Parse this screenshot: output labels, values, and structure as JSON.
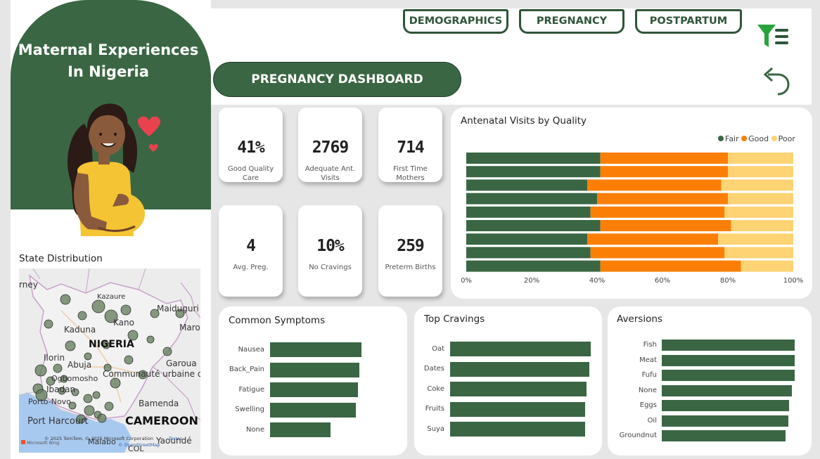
{
  "app": {
    "title_line1": "Maternal Experiences",
    "title_line2": "In Nigeria"
  },
  "nav": {
    "demographics": "DEMOGRAPHICS",
    "pregnancy": "PREGNANCY",
    "postpartum": "POSTPARTUM",
    "filter_icon": "filter-list-icon",
    "back_icon": "undo-arrow-icon"
  },
  "dashboard_title": "PREGNANCY DASHBOARD",
  "colors": {
    "green": "#3a6644",
    "orange": "#fb7f07",
    "yellow": "#fdd374"
  },
  "kpis": [
    {
      "value": "41%",
      "label1": "Good Quality",
      "label2": "Care"
    },
    {
      "value": "2769",
      "label1": "Adequate Ant.",
      "label2": "Visits"
    },
    {
      "value": "714",
      "label1": "First Time",
      "label2": "Mothers"
    },
    {
      "value": "4",
      "label1": "Avg. Preg.",
      "label2": ""
    },
    {
      "value": "10%",
      "label1": "No Cravings",
      "label2": ""
    },
    {
      "value": "259",
      "label1": "Preterm Births",
      "label2": ""
    }
  ],
  "state_distribution": {
    "title": "State Distribution",
    "map_labels": [
      "rney",
      "Kazaure",
      "Maiduguri",
      "Kano",
      "Kaduna",
      "Maro",
      "NIGERIA",
      "Ilorin",
      "Abuja",
      "Garoua",
      "Communauté urbaine d",
      "Ibadan",
      "Ogbomosho",
      "Porto-Novo",
      "Bamenda",
      "Port Harcourt",
      "CAMEROON",
      "Malabo",
      "Yaoundé",
      "COL"
    ],
    "attribution": "© 2025 TomTom, © 2025 Microsoft Corporation",
    "attribution2": "© OpenStreetMap",
    "terms": "Terms",
    "bing": "Microsoft Bing"
  },
  "chart_data": [
    {
      "type": "bar",
      "title": "Antenatal Visits by Quality",
      "orientation": "horizontal-stacked-100",
      "legend": [
        "Fair",
        "Good",
        "Poor"
      ],
      "legend_position": "top-right",
      "xticks": [
        "0%",
        "20%",
        "40%",
        "60%",
        "80%",
        "100%"
      ],
      "series": [
        {
          "name": "Fair",
          "values": [
            41,
            41,
            37,
            40,
            38,
            41,
            37,
            38,
            41
          ]
        },
        {
          "name": "Good",
          "values": [
            39,
            39,
            41,
            40,
            41,
            40,
            40,
            41,
            43
          ]
        },
        {
          "name": "Poor",
          "values": [
            20,
            20,
            22,
            20,
            21,
            19,
            23,
            21,
            16
          ]
        }
      ]
    },
    {
      "type": "bar",
      "title": "Common Symptoms",
      "orientation": "horizontal",
      "categories": [
        "Nausea",
        "Back_Pain",
        "Fatigue",
        "Swelling",
        "None"
      ],
      "values": [
        100,
        98,
        96,
        94,
        66
      ]
    },
    {
      "type": "bar",
      "title": "Top Cravings",
      "orientation": "horizontal",
      "categories": [
        "Oat",
        "Dates",
        "Coke",
        "Fruits",
        "Suya"
      ],
      "values": [
        100,
        99,
        97,
        96,
        96
      ]
    },
    {
      "type": "bar",
      "title": "Aversions",
      "orientation": "horizontal",
      "categories": [
        "Fish",
        "Meat",
        "Fufu",
        "None",
        "Eggs",
        "Oil",
        "Groundnut"
      ],
      "values": [
        100,
        100,
        100,
        98,
        96,
        95,
        93
      ]
    }
  ]
}
